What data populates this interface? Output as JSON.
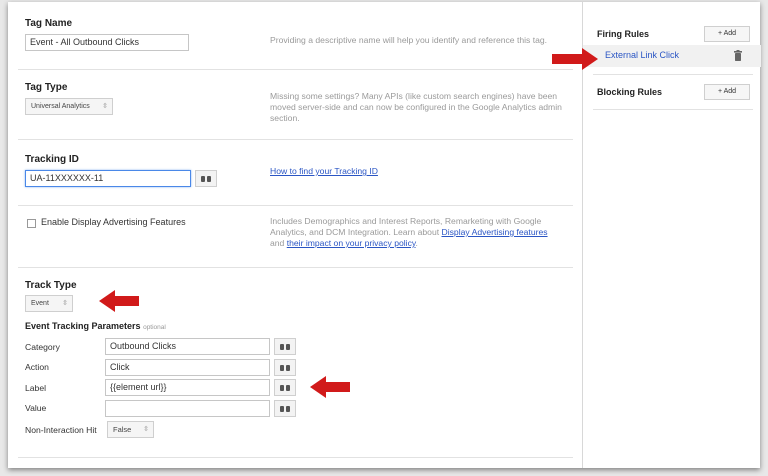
{
  "tag_name": {
    "label": "Tag Name",
    "value": "Event - All Outbound Clicks",
    "help": "Providing a descriptive name will help you identify and reference this tag."
  },
  "tag_type": {
    "label": "Tag Type",
    "value": "Universal Analytics",
    "help": "Missing some settings? Many APIs (like custom search engines) have been moved server-side and can now be configured in the Google Analytics admin section."
  },
  "tracking_id": {
    "label": "Tracking ID",
    "value": "UA-11XXXXXX-11",
    "help_link": "How to find your Tracking ID"
  },
  "display_advertising": {
    "label": "Enable Display Advertising Features",
    "checked": false,
    "help_prefix": "Includes Demographics and Interest Reports, Remarketing with Google Analytics, and DCM Integration. Learn about ",
    "help_link1": "Display Advertising features",
    "help_mid": " and ",
    "help_link2": "their impact on your privacy policy",
    "help_suffix": "."
  },
  "track_type": {
    "label": "Track Type",
    "value": "Event"
  },
  "event_params": {
    "title": "Event Tracking Parameters",
    "optional": "optional",
    "category_label": "Category",
    "category_value": "Outbound Clicks",
    "action_label": "Action",
    "action_value": "Click",
    "label_label": "Label",
    "label_value": "{{element url}}",
    "value_label": "Value",
    "value_value": "",
    "noninteraction_label": "Non-Interaction Hit",
    "noninteraction_value": "False"
  },
  "firing_rules": {
    "title": "Firing Rules",
    "add_label": "+ Add",
    "rules": [
      "External Link Click"
    ]
  },
  "blocking_rules": {
    "title": "Blocking Rules",
    "add_label": "+ Add"
  },
  "colors": {
    "arrow": "#d11a1a",
    "link": "#2a55c4",
    "focus_border": "#4a88e8"
  }
}
